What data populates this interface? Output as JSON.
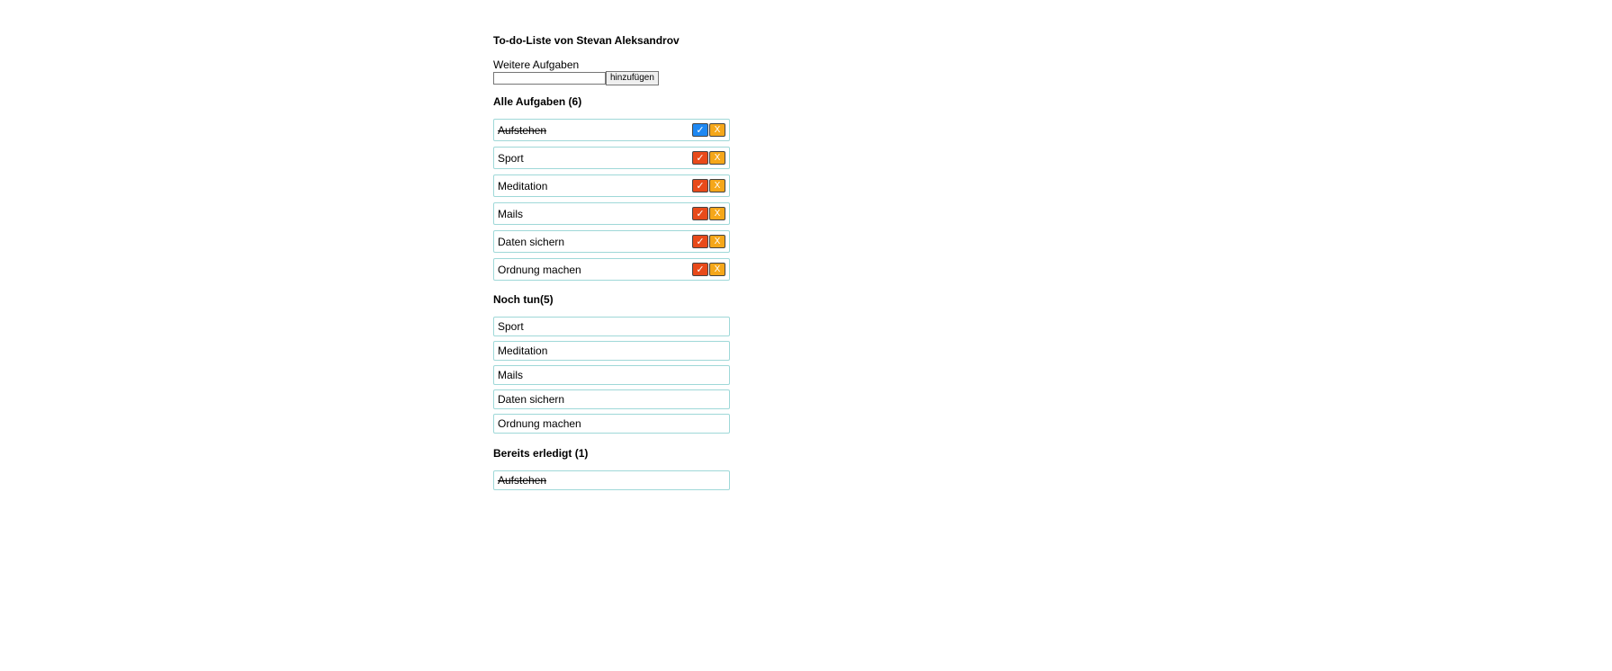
{
  "title": "To-do-Liste von Stevan Aleksandrov",
  "add": {
    "label": "Weitere Aufgaben",
    "value": "",
    "placeholder": "",
    "button_label": "hinzufügen"
  },
  "all": {
    "heading": "Alle Aufgaben (6)",
    "items": [
      {
        "label": "Aufstehen",
        "done": true,
        "check": "✓",
        "delete": "X"
      },
      {
        "label": "Sport",
        "done": false,
        "check": "✓",
        "delete": "X"
      },
      {
        "label": "Meditation",
        "done": false,
        "check": "✓",
        "delete": "X"
      },
      {
        "label": "Mails",
        "done": false,
        "check": "✓",
        "delete": "X"
      },
      {
        "label": "Daten sichern",
        "done": false,
        "check": "✓",
        "delete": "X"
      },
      {
        "label": "Ordnung machen",
        "done": false,
        "check": "✓",
        "delete": "X"
      }
    ]
  },
  "open": {
    "heading": "Noch tun(5)",
    "items": [
      "Sport",
      "Meditation",
      "Mails",
      "Daten sichern",
      "Ordnung machen"
    ]
  },
  "done": {
    "heading": "Bereits erledigt (1)",
    "items": [
      "Aufstehen"
    ]
  },
  "colors": {
    "check_open": "#e84a1a",
    "check_done": "#1e88f2",
    "delete": "#f5a71a",
    "item_border": "#9fd8d8"
  }
}
